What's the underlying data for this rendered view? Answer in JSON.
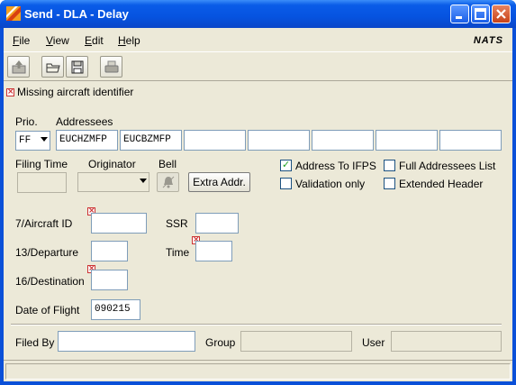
{
  "window": {
    "title": "Send - DLA - Delay"
  },
  "menu": {
    "items": [
      {
        "label": "File",
        "mnemonic": "F"
      },
      {
        "label": "View",
        "mnemonic": "V"
      },
      {
        "label": "Edit",
        "mnemonic": "E"
      },
      {
        "label": "Help",
        "mnemonic": "H"
      }
    ],
    "brand": "NATS"
  },
  "toolbar": {
    "icons": [
      "send-icon",
      "open-icon",
      "save-icon",
      "print-icon"
    ]
  },
  "error": {
    "message": "Missing aircraft identifier"
  },
  "form": {
    "prio_label": "Prio.",
    "prio_value": "FF",
    "addressees_label": "Addressees",
    "addressees": [
      "EUCHZMFP",
      "EUCBZMFP",
      "",
      "",
      "",
      "",
      ""
    ],
    "filing_time_label": "Filing Time",
    "filing_time_value": "",
    "originator_label": "Originator",
    "originator_value": "",
    "bell_label": "Bell",
    "extra_addr_label": "Extra Addr.",
    "address_to_ifps_label": "Address To IFPS",
    "address_to_ifps_checked": true,
    "validation_only_label": "Validation only",
    "validation_only_checked": false,
    "full_addressees_label": "Full Addressees List",
    "full_addressees_checked": false,
    "extended_header_label": "Extended Header",
    "extended_header_checked": false,
    "aircraft_id_label": "7/Aircraft ID",
    "aircraft_id_value": "",
    "ssr_label": "SSR",
    "ssr_value": "",
    "departure_label": "13/Departure",
    "departure_value": "",
    "time_label": "Time",
    "time_value": "",
    "destination_label": "16/Destination",
    "destination_value": "",
    "date_of_flight_label": "Date of Flight",
    "date_of_flight_value": "090215",
    "filed_by_label": "Filed By",
    "filed_by_value": "",
    "group_label": "Group",
    "group_value": "",
    "user_label": "User",
    "user_value": ""
  },
  "colors": {
    "title_bar": "#0a5ce8",
    "error_mark": "#cc3333",
    "check_tick": "#21a121"
  }
}
